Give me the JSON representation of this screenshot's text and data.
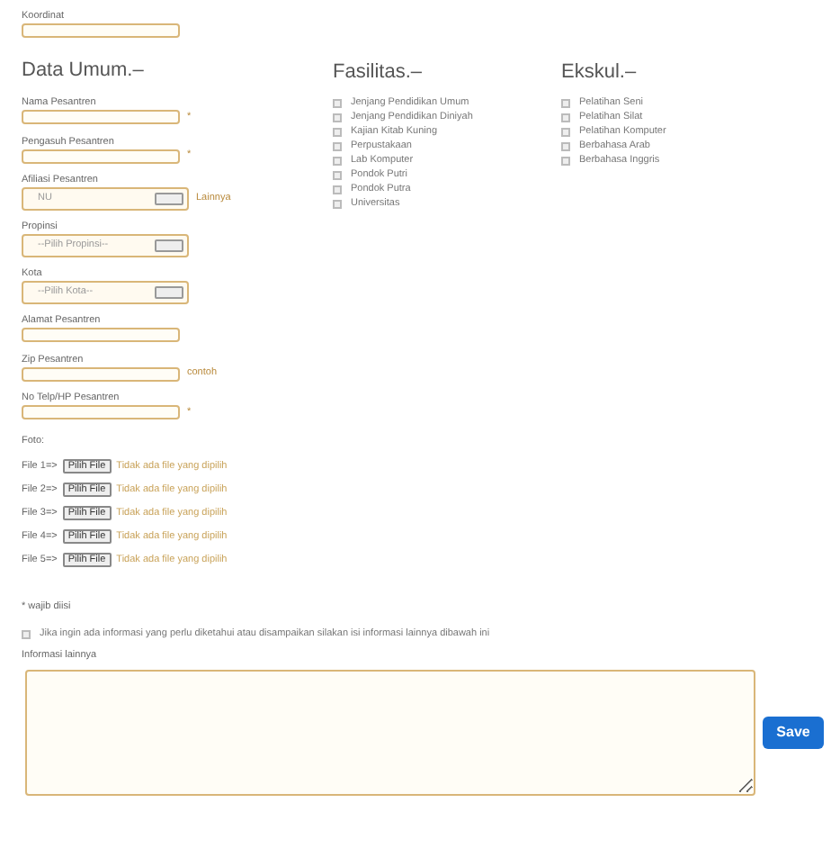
{
  "top_field": {
    "label": "Koordinat",
    "kind": "input"
  },
  "data_umum": {
    "heading": "Data Umum.–",
    "fields": [
      {
        "label": "Nama Pesantren",
        "kind": "input",
        "note": "*"
      },
      {
        "label": "Pengasuh Pesantren",
        "kind": "input",
        "note": "*"
      },
      {
        "label": "Afiliasi Pesantren",
        "kind": "select",
        "value": "NU",
        "note": "Lainnya"
      },
      {
        "label": "Propinsi",
        "kind": "select",
        "value": "--Pilih Propinsi--"
      },
      {
        "label": "Kota",
        "kind": "select",
        "value": "--Pilih Kota--"
      },
      {
        "label": "Alamat Pesantren",
        "kind": "input"
      },
      {
        "label": "Zip Pesantren",
        "kind": "input",
        "note": "contoh"
      },
      {
        "label": "No Telp/HP Pesantren",
        "kind": "input",
        "note": "*"
      }
    ]
  },
  "foto": {
    "label": "Foto:",
    "files": [
      {
        "label": "File 1=>",
        "button": "Pilih File",
        "status": "Tidak ada file yang dipilih"
      },
      {
        "label": "File 2=>",
        "button": "Pilih File",
        "status": "Tidak ada file yang dipilih"
      },
      {
        "label": "File 3=>",
        "button": "Pilih File",
        "status": "Tidak ada file yang dipilih"
      },
      {
        "label": "File 4=>",
        "button": "Pilih File",
        "status": "Tidak ada file yang dipilih"
      },
      {
        "label": "File 5=>",
        "button": "Pilih File",
        "status": "Tidak ada file yang dipilih"
      }
    ]
  },
  "fasilitas": {
    "heading": "Fasilitas.–",
    "items": [
      {
        "label": "Jenjang Pendidikan Umum",
        "checked": false
      },
      {
        "label": "Jenjang Pendidikan Diniyah",
        "checked": false
      },
      {
        "label": "Kajian Kitab Kuning",
        "checked": false
      },
      {
        "label": "Perpustakaan",
        "checked": false
      },
      {
        "label": "Lab Komputer",
        "checked": false
      },
      {
        "label": "Pondok Putri",
        "checked": false
      },
      {
        "label": "Pondok Putra",
        "checked": false
      },
      {
        "label": "Universitas",
        "checked": false
      }
    ]
  },
  "ekskul": {
    "heading": "Ekskul.–",
    "items": [
      {
        "label": "Pelatihan Seni",
        "checked": false
      },
      {
        "label": "Pelatihan Silat",
        "checked": false
      },
      {
        "label": "Pelatihan Komputer",
        "checked": false
      },
      {
        "label": "Berbahasa Arab",
        "checked": false
      },
      {
        "label": "Berbahasa Inggris",
        "checked": false
      }
    ]
  },
  "required_note": "* wajib diisi",
  "consent": {
    "label": "Jika ingin ada informasi yang perlu diketahui atau disampaikan silakan isi informasi lainnya dibawah ini",
    "checked": false
  },
  "other_info": {
    "label": "Informasi lainnya"
  },
  "save_button": "Save"
}
